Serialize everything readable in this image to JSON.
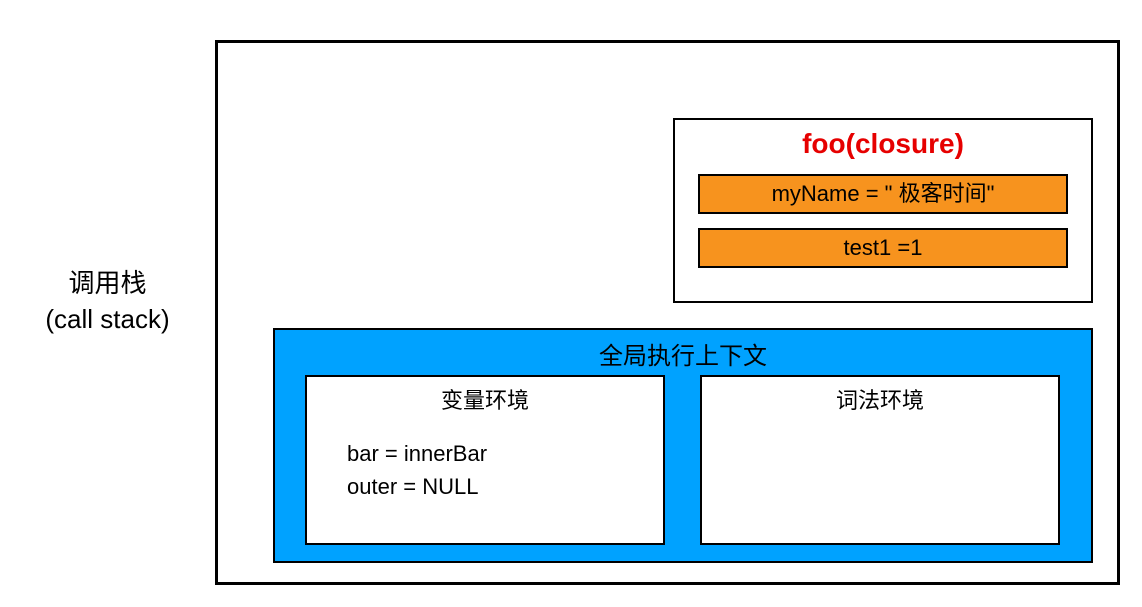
{
  "label": {
    "line1": "调用栈",
    "line2": "(call stack)"
  },
  "closure": {
    "title": "foo(closure)",
    "slots": [
      "myName = \" 极客时间\"",
      "test1 =1"
    ]
  },
  "globalCtx": {
    "title": "全局执行上下文",
    "variableEnv": {
      "title": "变量环境",
      "lines": [
        "bar =  innerBar",
        "outer = NULL"
      ]
    },
    "lexicalEnv": {
      "title": "词法环境",
      "lines": []
    }
  }
}
